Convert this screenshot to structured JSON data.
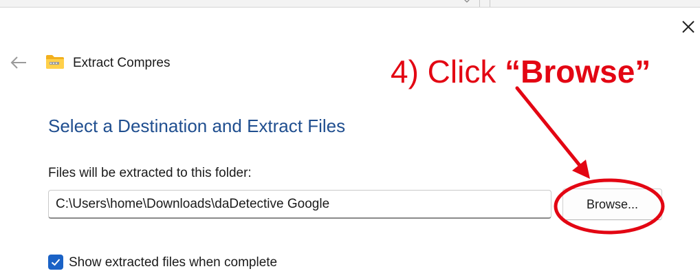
{
  "window": {
    "title": "Extract Compres",
    "close_icon": "close-icon",
    "back_icon": "back-arrow-icon",
    "folder_icon": "zip-folder-icon"
  },
  "main": {
    "heading": "Select a Destination and Extract Files",
    "folder_label": "Files will be extracted to this folder:",
    "path_value": "C:\\Users\\home\\Downloads\\daDetective Google",
    "browse_label": "Browse...",
    "show_files_label": "Show extracted files when complete",
    "show_files_checked": true
  },
  "annotation": {
    "prefix": "4) Click ",
    "open_quote": "“",
    "emphasis": "Browse",
    "close_quote": "”",
    "color": "#e30613"
  },
  "colors": {
    "heading": "#1f4e8f",
    "checkbox": "#1a62c6",
    "annotation": "#e30613"
  }
}
